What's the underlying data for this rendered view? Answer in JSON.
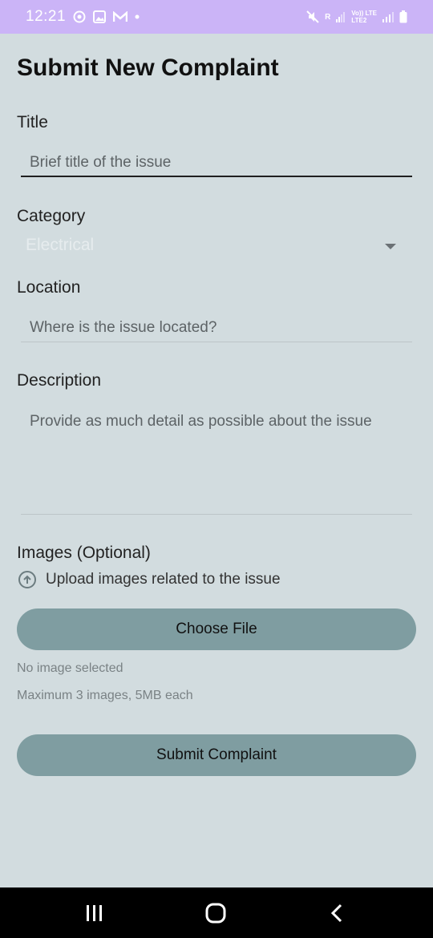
{
  "status_bar": {
    "time": "12:21",
    "net_line1": "Vo)) LTE",
    "net_line2": "LTE2",
    "sim_letter": "R",
    "icons": [
      "whatsapp-icon",
      "gallery-icon",
      "gmail-icon",
      "dot-icon",
      "mute-icon",
      "signal-icon",
      "battery-icon"
    ]
  },
  "form": {
    "title": "Submit New Complaint",
    "title_label": "Title",
    "title_placeholder": "Brief title of the issue",
    "category_label": "Category",
    "category_value": "Electrical",
    "location_label": "Location",
    "location_placeholder": "Where is the issue located?",
    "description_label": "Description",
    "description_placeholder": "Provide as much detail as possible about the issue",
    "images_label": "Images (Optional)",
    "upload_text": "Upload images related to the issue",
    "choose_file_label": "Choose File",
    "no_image_text": "No image selected",
    "limit_text": "Maximum 3 images, 5MB each",
    "submit_label": "Submit Complaint"
  },
  "nav": {
    "icons": [
      "recents-icon",
      "home-icon",
      "back-icon"
    ]
  },
  "colors": {
    "status_bar": "#cbb4f7",
    "background": "#d2dcdf",
    "button": "#7f9da1",
    "nav_bar": "#000000"
  }
}
